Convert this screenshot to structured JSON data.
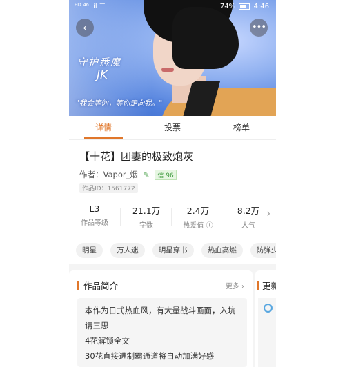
{
  "status_bar": {
    "left": "ᴴᴰ ⁴⁶ .il ☰",
    "battery": "74%",
    "time": "4:46"
  },
  "banner": {
    "title": "守护悉魔",
    "subtitle": "JK",
    "quote": "\"我会等你，等你走向我。\""
  },
  "tabs": [
    {
      "label": "详情"
    },
    {
      "label": "投票"
    },
    {
      "label": "榜单"
    }
  ],
  "book": {
    "title": "【十花】团妻的极致炮灰",
    "author_label": "作者：",
    "author": "Vapor_烟",
    "credit_badge": "信 96",
    "id_label": "作品ID：1561772"
  },
  "stats": [
    {
      "value": "L3",
      "label": "作品等级"
    },
    {
      "value": "21.1万",
      "label": "字数"
    },
    {
      "value": "2.4万",
      "label": "热爱值 ⓘ"
    },
    {
      "value": "8.2万",
      "label": "人气"
    }
  ],
  "tags": [
    "明星",
    "万人迷",
    "明星穿书",
    "热血高燃",
    "防弹少年团"
  ],
  "intro": {
    "heading": "作品简介",
    "more": "更多 ›",
    "lines": [
      "本作为日式热血风，有大量战斗画面，入坑",
      "请三思",
      "4花解锁全文",
      "30花直接进制霸通道将自动加满好感"
    ]
  },
  "update": {
    "heading": "更新"
  },
  "colors": {
    "accent": "#e0772b",
    "tab_active": "#e0772b"
  }
}
